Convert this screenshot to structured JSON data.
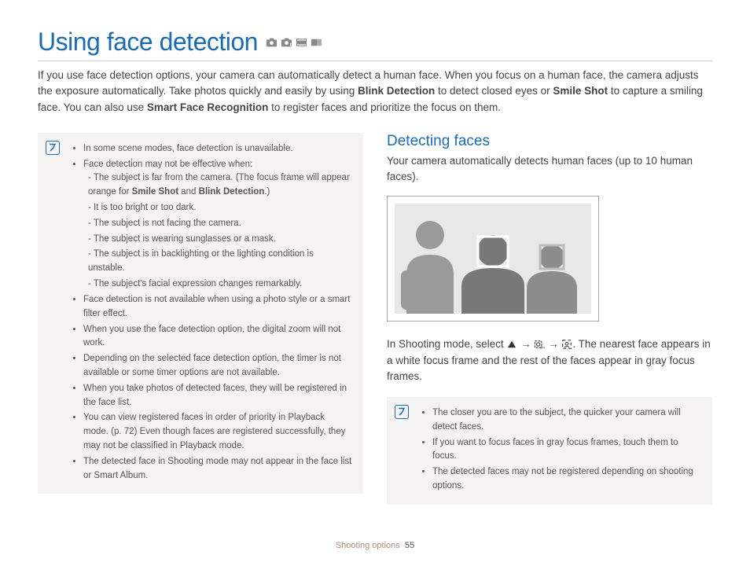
{
  "title": "Using face detection",
  "intro_segments": [
    {
      "t": "If you use face detection options, your camera can automatically detect a human face. When you focus on a human face, the camera adjusts the exposure automatically. Take photos quickly and easily by using "
    },
    {
      "t": "Blink Detection",
      "b": true
    },
    {
      "t": " to detect closed eyes or "
    },
    {
      "t": "Smile Shot",
      "b": true
    },
    {
      "t": " to capture a smiling face. You can also use "
    },
    {
      "t": "Smart Face Recognition",
      "b": true
    },
    {
      "t": " to register faces and prioritize the focus on them."
    }
  ],
  "left_notes": [
    {
      "text": "In some scene modes, face detection is unavailable."
    },
    {
      "text": "Face detection may not be effective when:",
      "sub": [
        {
          "segments": [
            {
              "t": "The subject is far from the camera. (The focus frame will appear orange for "
            },
            {
              "t": "Smile Shot",
              "b": true
            },
            {
              "t": " and "
            },
            {
              "t": "Blink Detection",
              "b": true
            },
            {
              "t": ".)"
            }
          ]
        },
        {
          "segments": [
            {
              "t": "It is too bright or too dark."
            }
          ]
        },
        {
          "segments": [
            {
              "t": "The subject is not facing the camera."
            }
          ]
        },
        {
          "segments": [
            {
              "t": "The subject is wearing sunglasses or a mask."
            }
          ]
        },
        {
          "segments": [
            {
              "t": "The subject is in backlighting or the lighting condition is unstable."
            }
          ]
        },
        {
          "segments": [
            {
              "t": "The subject's facial expression changes remarkably."
            }
          ]
        }
      ]
    },
    {
      "text": "Face detection is not available when using a photo style or a smart filter effect."
    },
    {
      "text": "When you use the face detection option, the digital zoom will not work."
    },
    {
      "text": "Depending on the selected face detection option, the timer is not available or some timer options are not available."
    },
    {
      "text": "When you take photos of detected faces, they will be registered in the face list."
    },
    {
      "text": "You can view registered faces in order of priority in Playback mode. (p. 72) Even though faces are registered successfully, they may not be classified in Playback mode."
    },
    {
      "text": "The detected face in Shooting mode may not appear in the face list or Smart Album."
    }
  ],
  "right": {
    "heading": "Detecting faces",
    "lead": "Your camera automatically detects human faces (up to 10 human faces).",
    "steps_pre": "In Shooting mode, select ",
    "steps_post": ". The nearest face appears in a white focus frame and the rest of the faces appear in gray focus frames.",
    "arrow": "→",
    "notes": [
      "The closer you are to the subject, the quicker your camera will detect faces.",
      "If you want to focus faces in gray focus frames, touch them to focus.",
      "The detected faces may not be registered depending on shooting options."
    ]
  },
  "footer": {
    "section": "Shooting options",
    "page": "55"
  }
}
